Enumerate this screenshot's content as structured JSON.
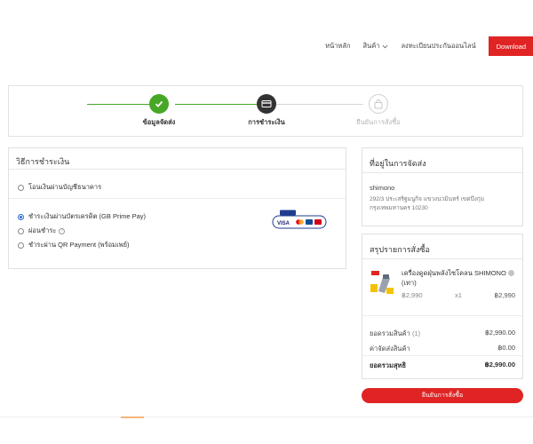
{
  "nav": {
    "home": "หน้าหลัก",
    "products": "สินค้า",
    "warranty": "ลงทะเบียนประกันออนไลน์",
    "download": "Download"
  },
  "steps": [
    {
      "label": "ข้อมูลจัดส่ง",
      "state": "done"
    },
    {
      "label": "การชำระเงิน",
      "state": "active"
    },
    {
      "label": "ยืนยันการสั่งซื้อ",
      "state": "pending"
    }
  ],
  "payment": {
    "title": "วิธีการชำระเงิน",
    "bank_transfer": "โอนเงินผ่านบัญชีธนาคาร",
    "options": [
      {
        "label": "ชำระเงินผ่านบัตรเครดิต (GB Prime Pay)",
        "checked": true
      },
      {
        "label": "ผ่อนชำระ",
        "checked": false
      },
      {
        "label": "ชำระผ่าน QR Payment (พร้อมเพย์)",
        "checked": false
      }
    ],
    "card_logo_text": "VISA"
  },
  "address": {
    "title": "ที่อยู่ในการจัดส่ง",
    "name": "shimono",
    "line1": "292/3 ประเสริฐมนูกิจ แขวงนวมินทร์ เขตบึงกุ่ม",
    "line2": "กรุงเทพมหานคร 10230"
  },
  "summary": {
    "title": "สรุปรายการสั่งซื้อ",
    "product_name": "เครื่องดูดฝุ่นพลังไซโคลน SHIMONO",
    "product_color": "(เทา)",
    "product_price": "฿2,990",
    "product_qty": "x1",
    "product_total": "฿2,990",
    "subtotal_label": "ยอดรวมสินค้า",
    "subtotal_count": "(1)",
    "subtotal_value": "฿2,990.00",
    "shipping_label": "ค่าจัดส่งสินค้า",
    "shipping_value": "฿0.00",
    "total_label": "ยอดรวมสุทธิ",
    "total_value": "฿2,990.00"
  },
  "confirm_button": "ยืนยันการสั่งซื้อ",
  "colors": {
    "accent": "#e02424",
    "step_done": "#47a826",
    "step_active": "#333333",
    "radio_checked": "#2a6bd6"
  }
}
